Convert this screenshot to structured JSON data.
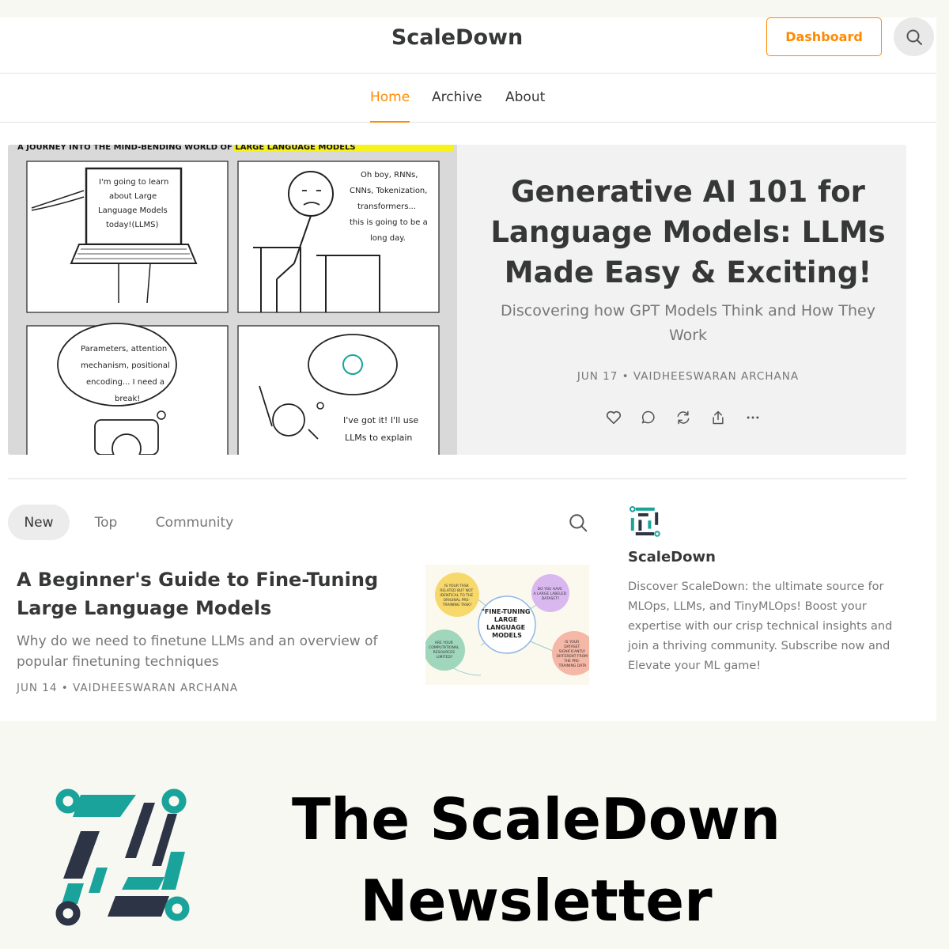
{
  "header": {
    "brand": "ScaleDown",
    "dashboard_label": "Dashboard",
    "search_icon": "search-icon"
  },
  "nav": {
    "items": [
      {
        "label": "Home",
        "active": true
      },
      {
        "label": "Archive",
        "active": false
      },
      {
        "label": "About",
        "active": false
      }
    ]
  },
  "hero": {
    "title": "Generative AI 101 for Language Models: LLMs Made Easy & Exciting!",
    "subtitle": "Discovering how GPT Models Think and How They Work",
    "meta": "JUN 17 • VAIDHEESWARAN ARCHANA",
    "actions": [
      "heart-icon",
      "comment-icon",
      "restack-icon",
      "share-icon",
      "more-icon"
    ],
    "comic": {
      "banner_text": "A JOURNEY INTO THE MIND-BENDING WORLD OF LARGE LANGUAGE MODELS",
      "panel1": [
        "I'm going to learn",
        "about Large",
        "Language Models",
        "today!(LLMS)"
      ],
      "panel2": [
        "Oh boy, RNNs,",
        "CNNs, Tokenization,",
        "transformers...",
        "this is going to be a",
        "long day."
      ],
      "panel3": [
        "Parameters, attention",
        "mechanism, positional",
        "encoding... I need a",
        "break!"
      ],
      "panel4": [
        "I've got it! I'll use",
        "LLMs to explain"
      ]
    }
  },
  "feed": {
    "tabs": [
      {
        "label": "New",
        "active": true
      },
      {
        "label": "Top",
        "active": false
      },
      {
        "label": "Community",
        "active": false
      }
    ],
    "search_icon": "search-icon",
    "post": {
      "title": "A Beginner's Guide to Fine-Tuning Large Language Models",
      "subtitle": "Why do we need to finetune LLMs and an overview of popular finetuning techniques",
      "meta": "JUN 14 • VAIDHEESWARAN ARCHANA",
      "thumb": {
        "center": [
          "\"FINE-TUNING",
          "LARGE",
          "LANGUAGE",
          "MODELS"
        ],
        "yellow": [
          "IS YOUR TASK",
          "RELATED BUT NOT",
          "IDENTICAL TO THE",
          "ORIGINAL PRE-",
          "TRAINING TASK?"
        ],
        "purple": [
          "DO YOU HAVE",
          "A LARGE LABELED",
          "DATASET?"
        ],
        "green": [
          "ARE YOUR",
          "COMPUTATIONAL",
          "RESOURCES",
          "LIMITED?"
        ],
        "pink": [
          "IS YOUR",
          "DATASET",
          "SIGNIFICANTLY",
          "DIFFERENT FROM",
          "THE PRE-",
          "TRAINING DATA"
        ]
      }
    }
  },
  "sidebar": {
    "name": "ScaleDown",
    "description": "Discover ScaleDown: the ultimate source for MLOps, LLMs, and TinyMLOps! Boost your expertise with our crisp technical insights and join a thriving community. Subscribe now and Elevate your ML game!"
  },
  "banner": {
    "line1": "The ScaleDown",
    "line2": "Newsletter"
  },
  "colors": {
    "accent": "#ff8a00",
    "logo_teal": "#1aa39a",
    "logo_navy": "#2c3445"
  }
}
